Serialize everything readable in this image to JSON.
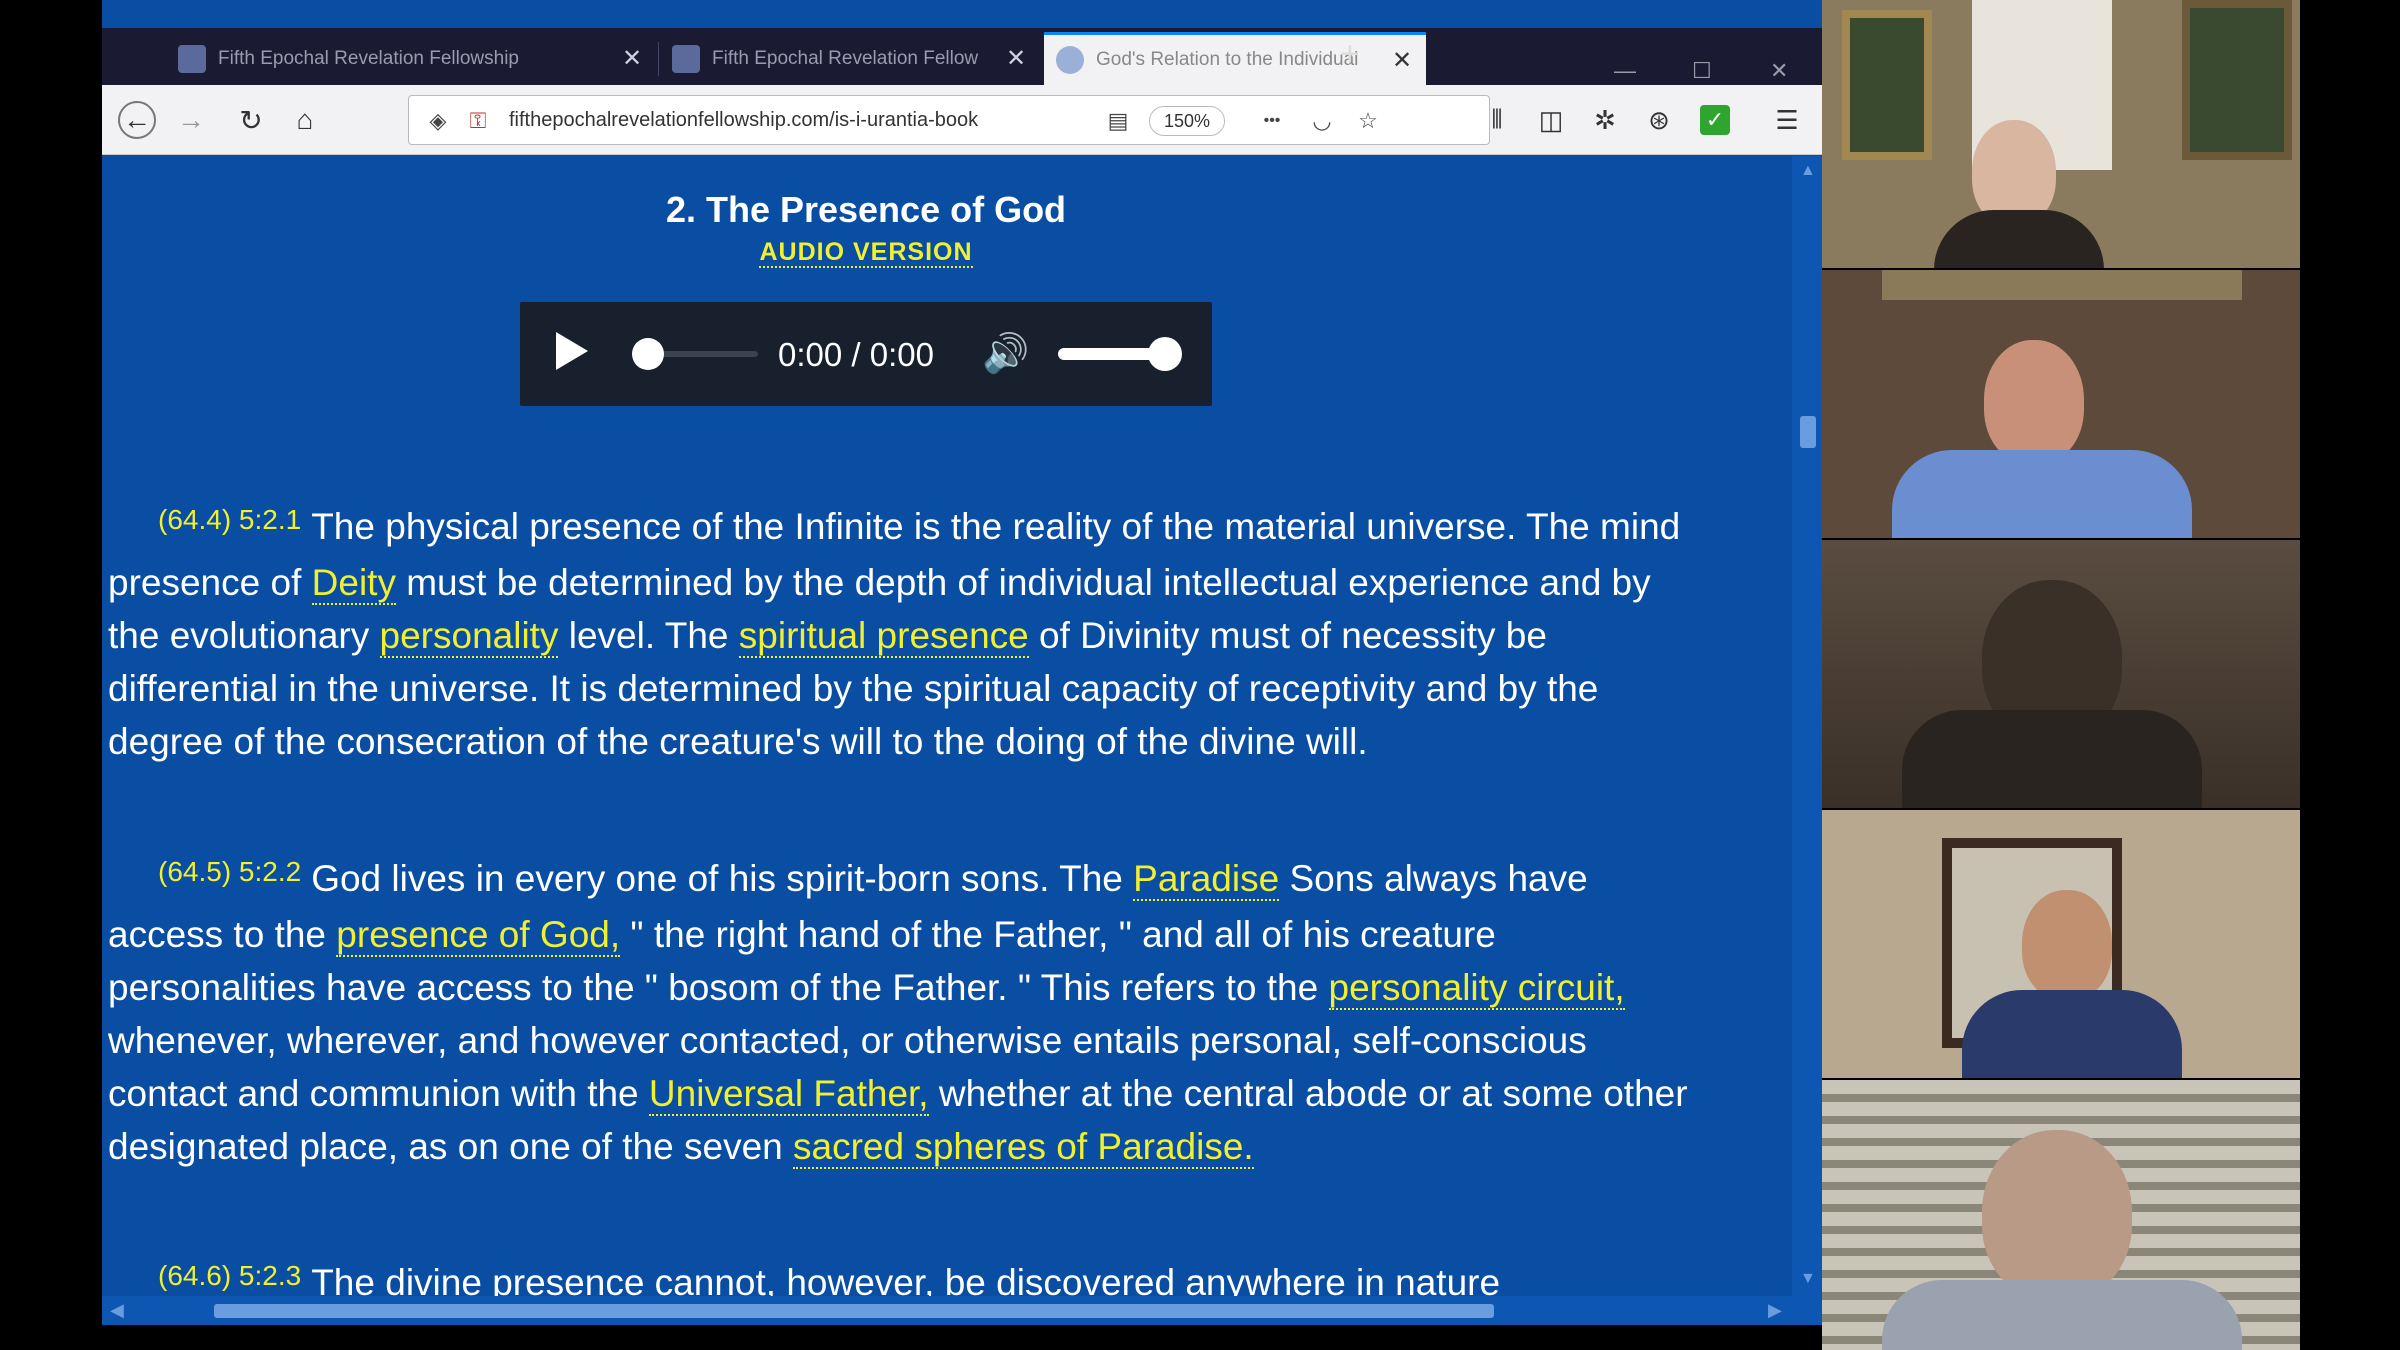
{
  "browser": {
    "tabs": [
      {
        "title": "Fifth Epochal Revelation Fellowship",
        "active": false
      },
      {
        "title": "Fifth Epochal Revelation Fellow",
        "active": false
      },
      {
        "title": "God's Relation to the Individual",
        "active": true
      }
    ],
    "new_tab_label": "+",
    "url": "fifthepochalrevelationfellowship.com/is-i-urantia-book",
    "zoom": "150%",
    "overflow_label": "•••"
  },
  "page": {
    "section_title": "2. The Presence of God",
    "audio_link": "AUDIO VERSION",
    "audio": {
      "time": "0:00 / 0:00"
    },
    "paragraphs": [
      {
        "ref": "(64.4) 5:2.1",
        "segments": [
          {
            "text": "The physical presence of the Infinite is the reality of the material universe. The mind presence of ",
            "link": false
          },
          {
            "text": "Deity",
            "link": true
          },
          {
            "text": " must be determined by the depth of individual intellectual experience and by the evolutionary ",
            "link": false
          },
          {
            "text": "personality",
            "link": true
          },
          {
            "text": " level. The ",
            "link": false
          },
          {
            "text": "spiritual presence",
            "link": true
          },
          {
            "text": " of Divinity must of necessity be differential in the universe. It is determined by the spiritual capacity of receptivity and by the degree of the consecration of the creature's will to the doing of the divine will.",
            "link": false
          }
        ]
      },
      {
        "ref": "(64.5) 5:2.2",
        "segments": [
          {
            "text": "God lives in every one of his spirit-born sons. The ",
            "link": false
          },
          {
            "text": "Paradise",
            "link": true
          },
          {
            "text": " Sons always have access to the ",
            "link": false
          },
          {
            "text": "presence of God,",
            "link": true
          },
          {
            "text": " \" the right hand of the Father, \" and all of his creature personalities have access to the \" bosom of the Father. \" This refers to the ",
            "link": false
          },
          {
            "text": "personality circuit,",
            "link": true
          },
          {
            "text": " whenever, wherever, and however contacted, or otherwise entails personal, self-conscious contact and communion with the ",
            "link": false
          },
          {
            "text": "Universal Father,",
            "link": true
          },
          {
            "text": " whether at the central abode or at some other designated place, as on one of the seven ",
            "link": false
          },
          {
            "text": "sacred spheres of Paradise.",
            "link": true
          }
        ]
      },
      {
        "ref": "(64.6) 5:2.3",
        "segments": [
          {
            "text": "The divine presence cannot, however, be discovered anywhere in nature",
            "link": false
          }
        ]
      }
    ]
  },
  "colors": {
    "page_background": "#0a4ea3",
    "link": "#f0f030",
    "text": "#ffffff",
    "player": "#17202c"
  },
  "video_tiles": [
    {
      "name": "participant-1",
      "bg": "#8a7a5e",
      "skin": "#d8b6a0",
      "shirt": "#2a2420"
    },
    {
      "name": "participant-2",
      "bg": "#5e4a3a",
      "skin": "#c89078",
      "shirt": "#6a8ed0"
    },
    {
      "name": "participant-3",
      "bg": "#4a4036",
      "skin": "#3a3028",
      "shirt": "#2a2420"
    },
    {
      "name": "participant-4",
      "bg": "#b8a890",
      "skin": "#c09070",
      "shirt": "#2a3a6a"
    },
    {
      "name": "participant-5",
      "bg": "#8a8678",
      "skin": "#b89a86",
      "shirt": "#9aa2b0"
    }
  ]
}
